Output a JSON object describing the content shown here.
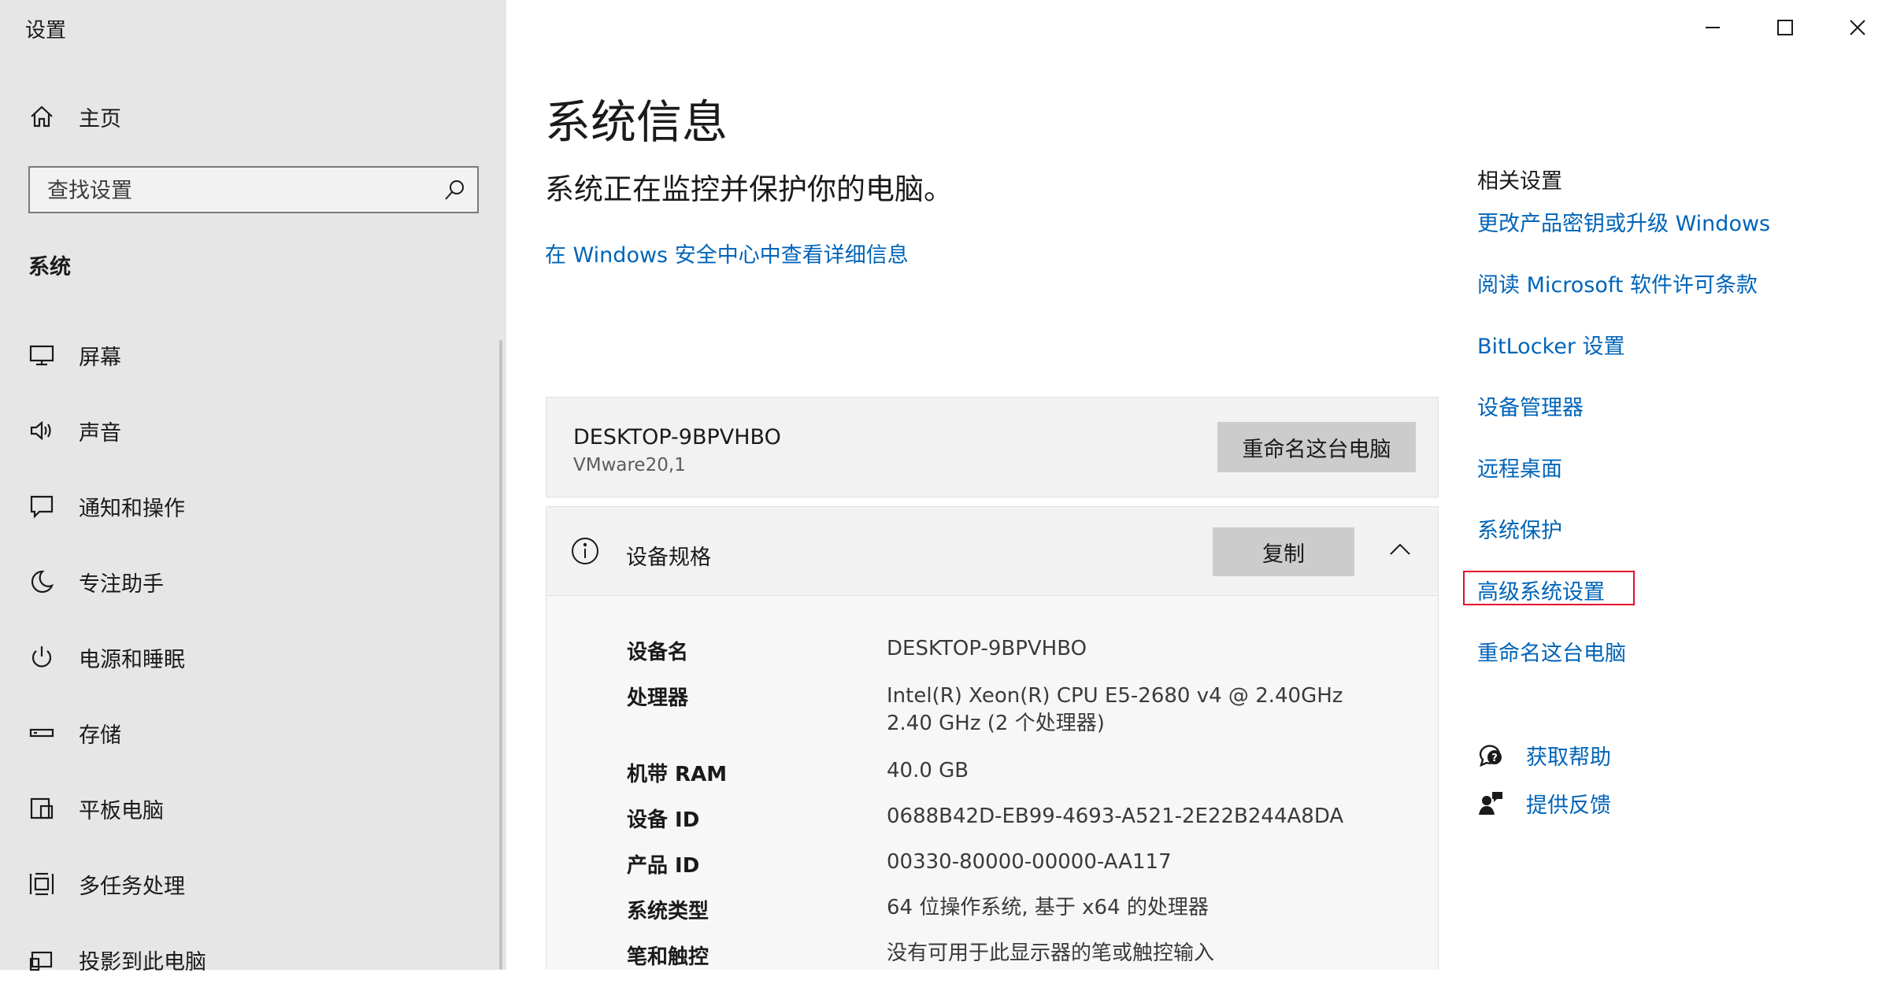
{
  "window": {
    "title": "设置"
  },
  "sidebar": {
    "home_label": "主页",
    "search_placeholder": "查找设置",
    "section_heading": "系统",
    "items": [
      {
        "label": "屏幕",
        "icon": "monitor-icon"
      },
      {
        "label": "声音",
        "icon": "speaker-icon"
      },
      {
        "label": "通知和操作",
        "icon": "notification-icon"
      },
      {
        "label": "专注助手",
        "icon": "moon-icon"
      },
      {
        "label": "电源和睡眠",
        "icon": "power-icon"
      },
      {
        "label": "存储",
        "icon": "storage-icon"
      },
      {
        "label": "平板电脑",
        "icon": "tablet-icon"
      },
      {
        "label": "多任务处理",
        "icon": "multitask-icon"
      },
      {
        "label": "投影到此电脑",
        "icon": "project-icon"
      }
    ]
  },
  "main": {
    "title": "系统信息",
    "subtitle": "系统正在监控并保护你的电脑。",
    "security_link": "在 Windows 安全中心中查看详细信息",
    "pc_name": "DESKTOP-9BPVHBO",
    "pc_model": "VMware20,1",
    "rename_button": "重命名这台电脑",
    "specs": {
      "title": "设备规格",
      "copy_button": "复制",
      "rows": [
        {
          "label": "设备名",
          "value": "DESKTOP-9BPVHBO"
        },
        {
          "label": "处理器",
          "value": "Intel(R) Xeon(R) CPU E5-2680 v4 @ 2.40GHz",
          "value2": "2.40 GHz (2 个处理器)"
        },
        {
          "label": "机带 RAM",
          "value": "40.0 GB"
        },
        {
          "label": "设备 ID",
          "value": "0688B42D-EB99-4693-A521-2E22B244A8DA"
        },
        {
          "label": "产品 ID",
          "value": "00330-80000-00000-AA117"
        },
        {
          "label": "系统类型",
          "value": "64 位操作系统, 基于 x64 的处理器"
        },
        {
          "label": "笔和触控",
          "value": "没有可用于此显示器的笔或触控输入"
        }
      ]
    }
  },
  "related": {
    "heading": "相关设置",
    "links": [
      "更改产品密钥或升级 Windows",
      "阅读 Microsoft 软件许可条款",
      "BitLocker 设置",
      "设备管理器",
      "远程桌面",
      "系统保护",
      "高级系统设置",
      "重命名这台电脑"
    ],
    "help_label": "获取帮助",
    "feedback_label": "提供反馈"
  },
  "colors": {
    "link": "#0064b8",
    "highlight": "#e0102a",
    "sidebar_bg": "#e6e6e6"
  }
}
